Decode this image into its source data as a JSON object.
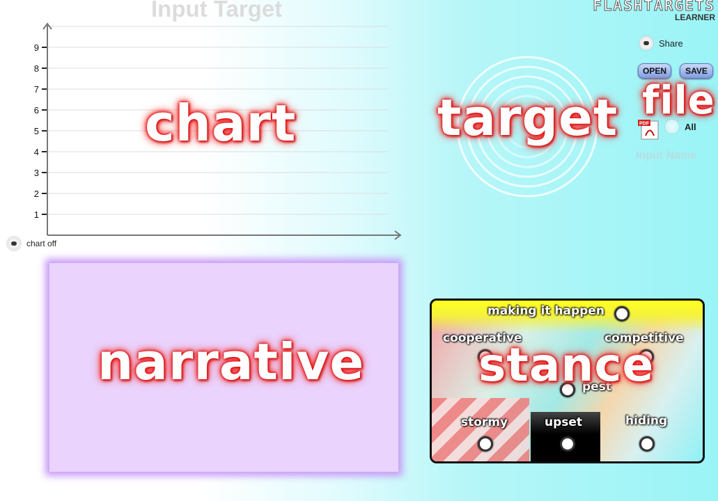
{
  "header": {
    "title": "Input Target",
    "brand": "FLASHTARGETS",
    "brand_sub": "LEARNER"
  },
  "chart_panel": {
    "label": "chart",
    "toggle_label": "chart off"
  },
  "chart_data": {
    "type": "line",
    "title": "",
    "xlabel": "",
    "ylabel": "",
    "ylim": [
      0,
      10
    ],
    "yticks": [
      1,
      2,
      3,
      4,
      5,
      6,
      7,
      8,
      9
    ],
    "grid": true,
    "series": []
  },
  "target_panel": {
    "label": "target"
  },
  "file_panel": {
    "share_label": "Share",
    "open_label": "OPEN",
    "save_label": "SAVE",
    "label": "file",
    "all_label": "All",
    "input_name": "Input Name",
    "pdf_icon": "pdf-icon"
  },
  "narrative_panel": {
    "label": "narrative"
  },
  "stance_panel": {
    "label": "stance",
    "options": {
      "making_it_happen": "making it happen",
      "cooperative": "cooperative",
      "competitive": "competitive",
      "pest": "pest",
      "stormy": "stormy",
      "upset": "upset",
      "hiding": "hiding"
    }
  },
  "colors": {
    "background_accent": "#9af4f6",
    "narrative_fill": "#ead3fd",
    "narrative_glow": "#c89af6",
    "label_glow": "#e22222",
    "stance_top": "#ffff22"
  }
}
